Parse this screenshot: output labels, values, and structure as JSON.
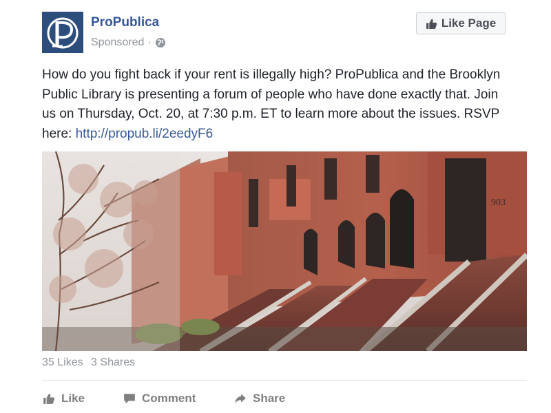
{
  "header": {
    "page_name": "ProPublica",
    "sponsored_label": "Sponsored",
    "separator": "·",
    "like_page_label": "Like Page"
  },
  "post": {
    "text": "How do you fight back if your rent is illegally high? ProPublica and the Brooklyn Public Library is presenting a forum of people who have done exactly that. Join us on Thursday, Oct. 20, at 7:30 p.m. ET to learn more about the issues. RSVP here: ",
    "link": "http://propub.li/2eedyF6",
    "image_icon": "brownstone-street-photo",
    "building_number": "903"
  },
  "stats": {
    "likes": "35 Likes",
    "shares": "3 Shares"
  },
  "actions": {
    "like": "Like",
    "comment": "Comment",
    "share": "Share"
  },
  "colors": {
    "brand": "#2d4e7c",
    "link": "#365899",
    "muted": "#90949c",
    "action": "#7f7f7f"
  },
  "icons": {
    "avatar": "propublica-logo-icon",
    "privacy": "globe-icon",
    "like_page": "thumbs-up-icon",
    "like": "thumbs-up-icon",
    "comment": "comment-icon",
    "share": "share-arrow-icon"
  }
}
